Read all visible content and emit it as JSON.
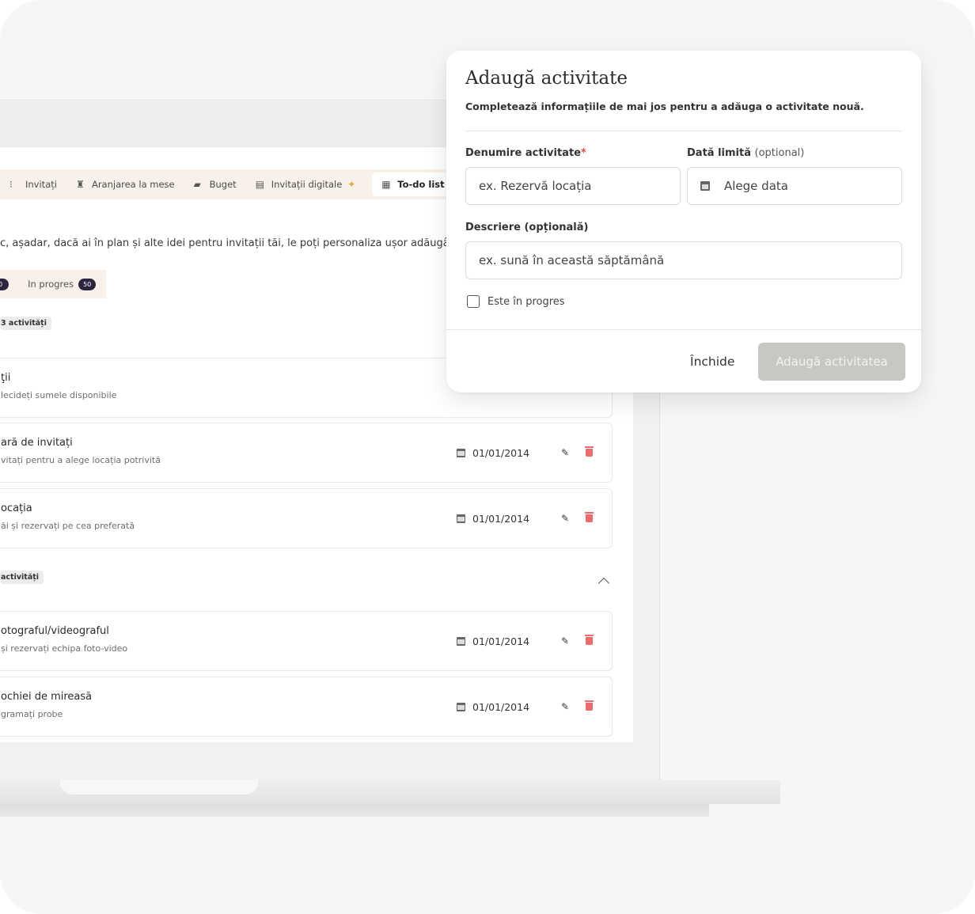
{
  "nav": {
    "tabs": [
      {
        "label": "Invitați",
        "icon": "guests-icon"
      },
      {
        "label": "Aranjarea la mese",
        "icon": "chair-icon"
      },
      {
        "label": "Buget",
        "icon": "wallet-icon"
      },
      {
        "label": "Invitații digitale",
        "icon": "envelope-icon"
      },
      {
        "label": "To-do list",
        "icon": "checklist-icon",
        "active": true
      }
    ]
  },
  "main": {
    "intro": "c, așadar, dacă ai în plan și alte idei pentru invitații tăi, le poți personaliza ușor adăugân",
    "filters": {
      "first_count": "0",
      "in_progress_label": "In progres",
      "in_progress_count": "50"
    },
    "groups": [
      {
        "badge": "3 activități",
        "tasks": [
          {
            "title": "ţii",
            "subtitle": "lecideți sumele disponibile"
          },
          {
            "title": "ară de invitați",
            "subtitle": "vitați pentru a alege locația potrivită",
            "date": "01/01/2014"
          },
          {
            "title": "ocația",
            "subtitle": "ăi și rezervați pe cea preferată",
            "date": "01/01/2014"
          }
        ]
      },
      {
        "badge": "activități",
        "tasks": [
          {
            "title": "otograful/videograful",
            "subtitle": "și rezervați echipa foto-video",
            "date": "01/01/2014"
          },
          {
            "title": "ochiei de mireasă",
            "subtitle": "gramați probe",
            "date": "01/01/2014"
          }
        ]
      }
    ]
  },
  "modal": {
    "title": "Adaugă activitate",
    "subtitle": "Completează informațiile de mai jos pentru a adăuga o activitate nouă.",
    "name_label": "Denumire activitate",
    "name_required": "*",
    "name_placeholder": "ex. Rezervă locația",
    "deadline_label": "Dată limită",
    "deadline_optional": "(optional)",
    "deadline_placeholder": "Alege data",
    "description_label": "Descriere (opțională)",
    "description_placeholder": "ex. sună în această săptămână",
    "in_progress_label": "Este în progres",
    "close_label": "Închide",
    "submit_label": "Adaugă activitatea"
  },
  "colors": {
    "accent_dark": "#2e2440",
    "tab_bg": "#f7f1ea",
    "delete_red": "#ef6b6b",
    "required_red": "#e0493e",
    "disabled_button": "#c9c7c4"
  }
}
